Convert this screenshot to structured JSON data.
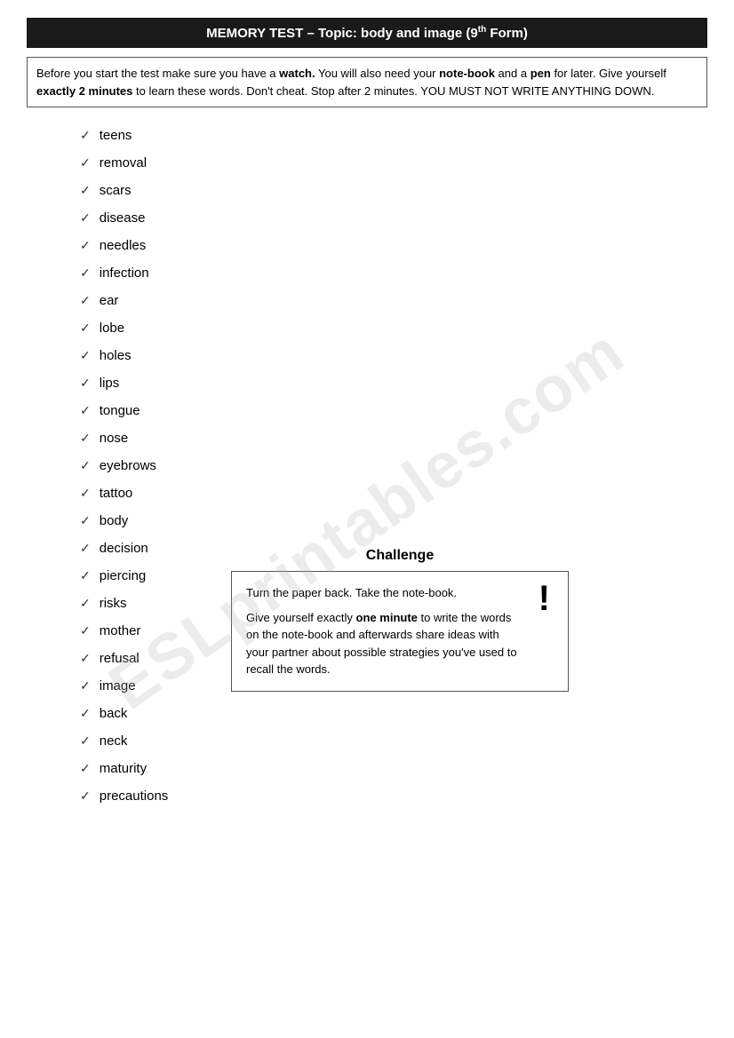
{
  "title": {
    "text": "MEMORY TEST – Topic: body and image (9",
    "superscript": "th",
    "suffix": " Form)"
  },
  "instructions": {
    "line1_pre": "Before you start the test make sure you have a ",
    "watch": "watch.",
    "line1_mid": " You will also need your ",
    "notebook": "note-book",
    "line1_mid2": " and a ",
    "pen": "pen",
    "line1_end": " for later. Give yourself ",
    "exactly": "exactly 2 minutes",
    "line1_end2": " to learn these words. Don't cheat. Stop after 2 minutes. YOU MUST NOT WRITE ANYTHING DOWN."
  },
  "words": [
    "teens",
    "removal",
    "scars",
    "disease",
    "needles",
    "infection",
    "ear",
    "lobe",
    "holes",
    "lips",
    "tongue",
    "nose",
    "eyebrows",
    "tattoo",
    "body",
    "decision",
    "piercing",
    "risks",
    "mother",
    "refusal",
    "image",
    "back",
    "neck",
    "maturity",
    "precautions"
  ],
  "challenge": {
    "title": "Challenge",
    "exclamation": "!",
    "line1": "Turn the paper back. Take the note-book.",
    "line2_pre": "Give yourself exactly ",
    "one_minute": "one minute",
    "line2_end": " to write the words on the note-book and afterwards share ideas with your partner about possible strategies you've used to recall the words."
  },
  "watermark": "ESLprintables.com"
}
